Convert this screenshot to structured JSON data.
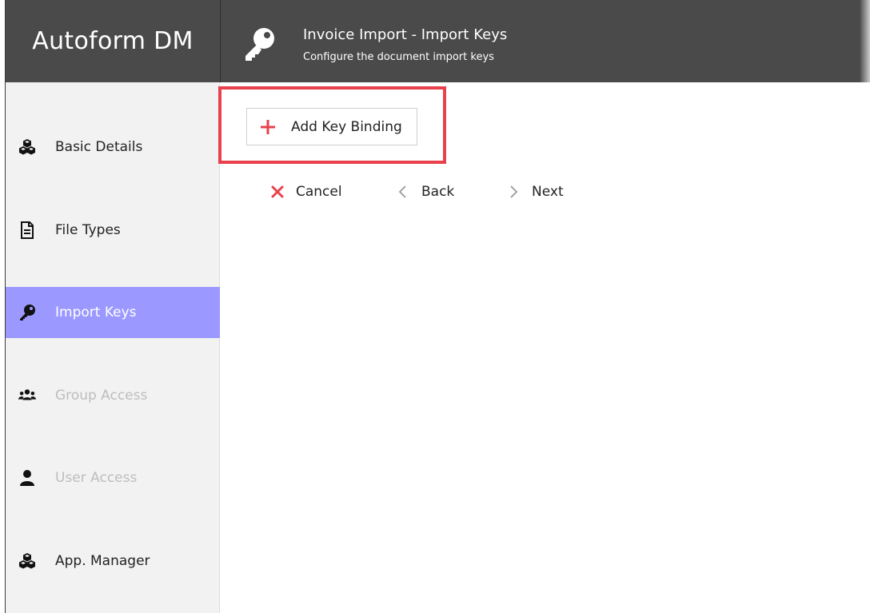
{
  "app": {
    "brand": "Autoform DM"
  },
  "header": {
    "icon": "key-icon",
    "title": "Invoice Import - Import Keys",
    "subtitle": "Configure the document import keys"
  },
  "sidebar": {
    "items": [
      {
        "label": "Basic Details",
        "icon": "cubes-icon",
        "state": "normal"
      },
      {
        "label": "File Types",
        "icon": "document-icon",
        "state": "normal"
      },
      {
        "label": "Import Keys",
        "icon": "key-icon",
        "state": "active"
      },
      {
        "label": "Group Access",
        "icon": "users-icon",
        "state": "disabled"
      },
      {
        "label": "User Access",
        "icon": "user-icon",
        "state": "disabled"
      },
      {
        "label": "App. Manager",
        "icon": "cubes-icon",
        "state": "normal"
      }
    ]
  },
  "toolbar": {
    "add_label": "Add Key Binding",
    "cancel_label": "Cancel",
    "back_label": "Back",
    "next_label": "Next"
  },
  "colors": {
    "header_bg": "#4a4a4a",
    "sidebar_bg": "#f2f2f2",
    "active_item": "#9b99ff",
    "highlight_border": "#e8414c",
    "add_plus": "#e8414c",
    "cancel_x": "#e8414c"
  }
}
